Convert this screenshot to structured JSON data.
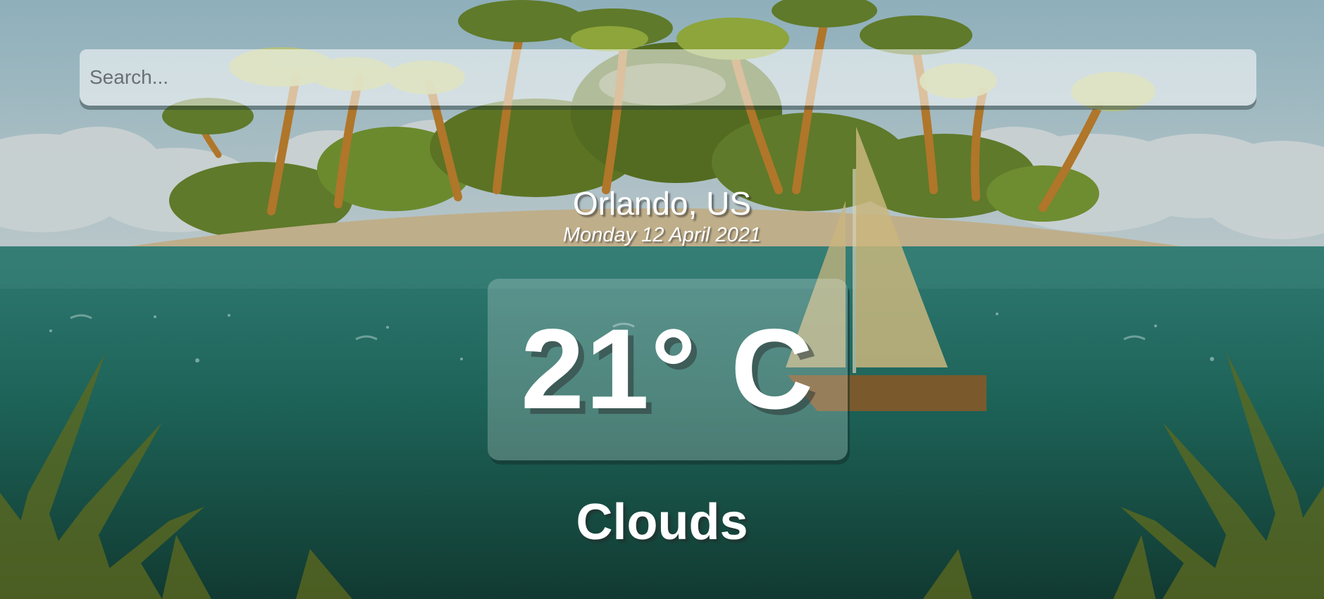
{
  "search": {
    "placeholder": "Search...",
    "value": ""
  },
  "location": {
    "city": "Orlando, US",
    "date": "Monday 12 April 2021"
  },
  "weather": {
    "temperature": "21° C",
    "condition": "Clouds"
  },
  "colors": {
    "sky_top": "#8fb0bc",
    "sky_bottom": "#b7c7cb",
    "sea_top": "#2e7a72",
    "sea_bottom": "#123f36",
    "sand": "#bfae8a",
    "palm_leaf": "#6f8a2f",
    "trunk": "#b0762a",
    "boat_hull": "#7a5a2c",
    "sail": "#c9b67d"
  }
}
